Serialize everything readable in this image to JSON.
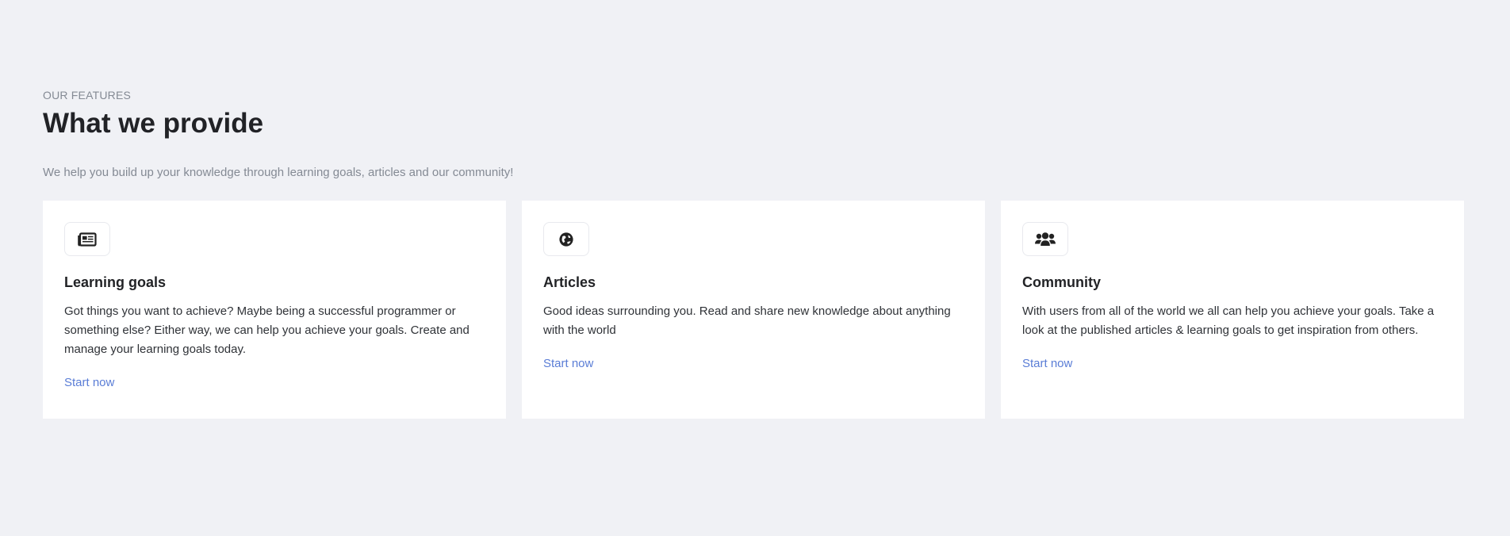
{
  "header": {
    "eyebrow": "OUR FEATURES",
    "title": "What we provide",
    "subtitle": "We help you build up your knowledge through learning goals, articles and our community!"
  },
  "cards": [
    {
      "icon": "newspaper-icon",
      "title": "Learning goals",
      "text": "Got things you want to achieve? Maybe being a successful programmer or something else? Either way, we can help you achieve your goals. Create and manage your learning goals today.",
      "link": "Start now"
    },
    {
      "icon": "globe-icon",
      "title": "Articles",
      "text": "Good ideas surrounding you. Read and share new knowledge about anything with the world",
      "link": "Start now"
    },
    {
      "icon": "users-icon",
      "title": "Community",
      "text": "With users from all of the world we all can help you achieve your goals. Take a look at the published articles & learning goals to get inspiration from others.",
      "link": "Start now"
    }
  ],
  "colors": {
    "background": "#f0f1f5",
    "card": "#ffffff",
    "link": "#5a7dd6",
    "muted_text": "#848a94"
  }
}
